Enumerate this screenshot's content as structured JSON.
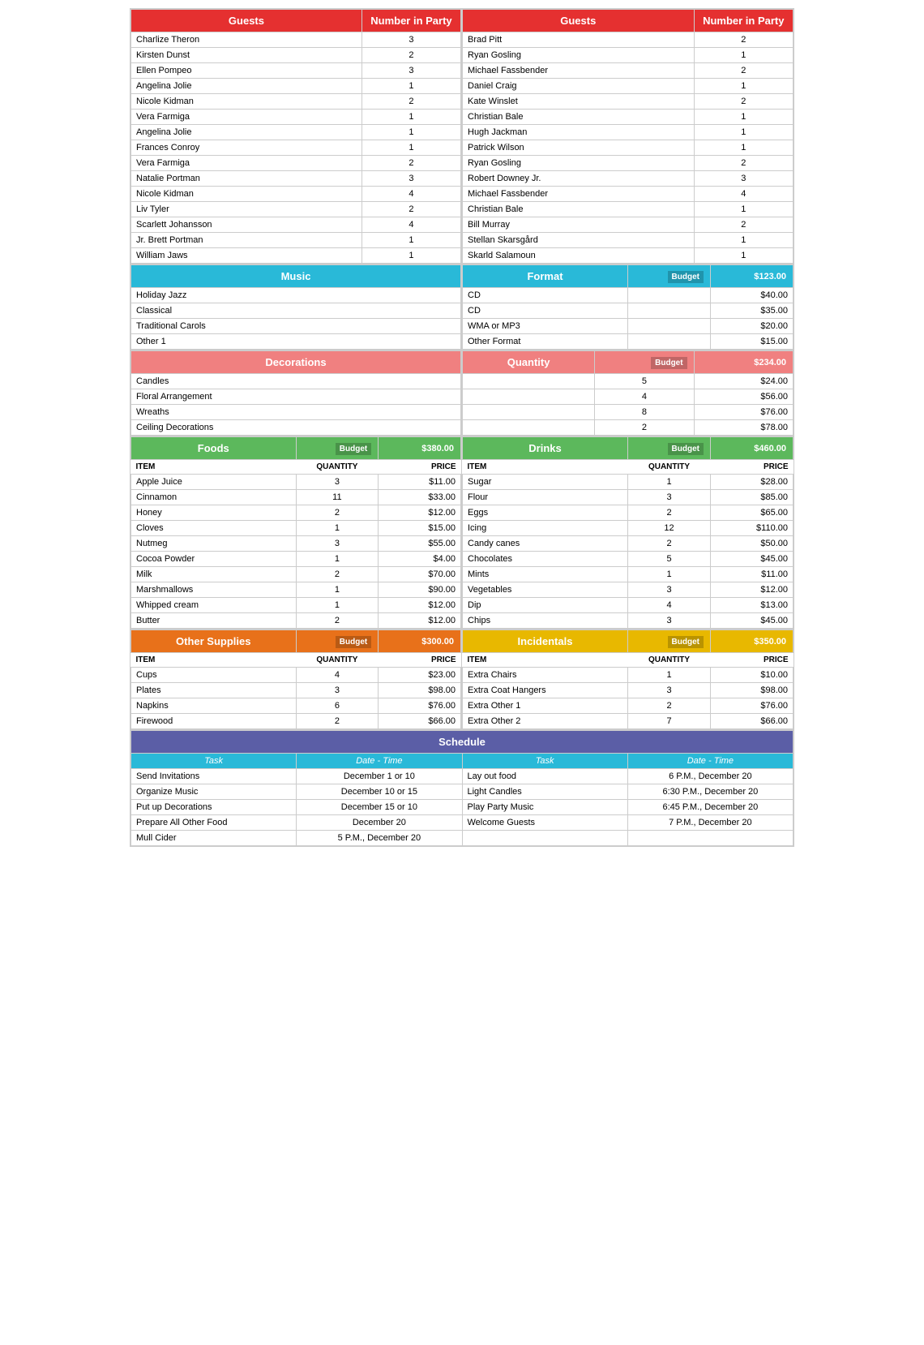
{
  "guests_left": {
    "header": "Guests",
    "col2": "Number in Party",
    "rows": [
      {
        "name": "Charlize Theron",
        "party": "3"
      },
      {
        "name": "Kirsten Dunst",
        "party": "2"
      },
      {
        "name": "Ellen Pompeo",
        "party": "3"
      },
      {
        "name": "Angelina Jolie",
        "party": "1"
      },
      {
        "name": "Nicole Kidman",
        "party": "2"
      },
      {
        "name": "Vera Farmiga",
        "party": "1"
      },
      {
        "name": "Angelina Jolie",
        "party": "1"
      },
      {
        "name": "Frances Conroy",
        "party": "1"
      },
      {
        "name": "Vera Farmiga",
        "party": "2"
      },
      {
        "name": "Natalie Portman",
        "party": "3"
      },
      {
        "name": "Nicole Kidman",
        "party": "4"
      },
      {
        "name": "Liv Tyler",
        "party": "2"
      },
      {
        "name": "Scarlett Johansson",
        "party": "4"
      },
      {
        "name": "Jr. Brett Portman",
        "party": "1"
      },
      {
        "name": "William Jaws",
        "party": "1"
      }
    ]
  },
  "guests_right": {
    "header": "Guests",
    "col2": "Number in Party",
    "rows": [
      {
        "name": "Brad Pitt",
        "party": "2"
      },
      {
        "name": "Ryan Gosling",
        "party": "1"
      },
      {
        "name": "Michael Fassbender",
        "party": "2"
      },
      {
        "name": "Daniel Craig",
        "party": "1"
      },
      {
        "name": "Kate Winslet",
        "party": "2"
      },
      {
        "name": "Christian Bale",
        "party": "1"
      },
      {
        "name": "Hugh Jackman",
        "party": "1"
      },
      {
        "name": "Patrick Wilson",
        "party": "1"
      },
      {
        "name": "Ryan Gosling",
        "party": "2"
      },
      {
        "name": "Robert Downey Jr.",
        "party": "3"
      },
      {
        "name": "Michael Fassbender",
        "party": "4"
      },
      {
        "name": "Christian Bale",
        "party": "1"
      },
      {
        "name": "Bill Murray",
        "party": "2"
      },
      {
        "name": "Stellan Skarsgård",
        "party": "1"
      },
      {
        "name": "Skarld Salamoun",
        "party": "1"
      }
    ]
  },
  "music": {
    "header": "Music",
    "rows": [
      "Holiday Jazz",
      "Classical",
      "Traditional Carols",
      "Other 1"
    ]
  },
  "format": {
    "header": "Format",
    "budget_label": "Budget",
    "budget": "$123.00",
    "rows": [
      {
        "name": "CD",
        "price": "$40.00"
      },
      {
        "name": "CD",
        "price": "$35.00"
      },
      {
        "name": "WMA or MP3",
        "price": "$20.00"
      },
      {
        "name": "Other Format",
        "price": "$15.00"
      }
    ]
  },
  "decorations": {
    "header": "Decorations",
    "rows": [
      "Candles",
      "Floral Arrangement",
      "Wreaths",
      "Ceiling Decorations"
    ]
  },
  "quantity": {
    "header": "Quantity",
    "budget_label": "Budget",
    "budget": "$234.00",
    "rows": [
      {
        "qty": "5",
        "price": "$24.00"
      },
      {
        "qty": "4",
        "price": "$56.00"
      },
      {
        "qty": "8",
        "price": "$76.00"
      },
      {
        "qty": "2",
        "price": "$78.00"
      }
    ]
  },
  "foods": {
    "header": "Foods",
    "budget_label": "Budget",
    "budget": "$380.00",
    "col_item": "ITEM",
    "col_qty": "QUANTITY",
    "col_price": "PRICE",
    "rows": [
      {
        "item": "Apple Juice",
        "qty": "3",
        "price": "$11.00"
      },
      {
        "item": "Cinnamon",
        "qty": "11",
        "price": "$33.00"
      },
      {
        "item": "Honey",
        "qty": "2",
        "price": "$12.00"
      },
      {
        "item": "Cloves",
        "qty": "1",
        "price": "$15.00"
      },
      {
        "item": "Nutmeg",
        "qty": "3",
        "price": "$55.00"
      },
      {
        "item": "Cocoa Powder",
        "qty": "1",
        "price": "$4.00"
      },
      {
        "item": "Milk",
        "qty": "2",
        "price": "$70.00"
      },
      {
        "item": "Marshmallows",
        "qty": "1",
        "price": "$90.00"
      },
      {
        "item": "Whipped cream",
        "qty": "1",
        "price": "$12.00"
      },
      {
        "item": "Butter",
        "qty": "2",
        "price": "$12.00"
      }
    ]
  },
  "drinks": {
    "header": "Drinks",
    "budget_label": "Budget",
    "budget": "$460.00",
    "col_item": "ITEM",
    "col_qty": "QUANTITY",
    "col_price": "PRICE",
    "rows": [
      {
        "item": "Sugar",
        "qty": "1",
        "price": "$28.00"
      },
      {
        "item": "Flour",
        "qty": "3",
        "price": "$85.00"
      },
      {
        "item": "Eggs",
        "qty": "2",
        "price": "$65.00"
      },
      {
        "item": "Icing",
        "qty": "12",
        "price": "$110.00"
      },
      {
        "item": "Candy canes",
        "qty": "2",
        "price": "$50.00"
      },
      {
        "item": "Chocolates",
        "qty": "5",
        "price": "$45.00"
      },
      {
        "item": "Mints",
        "qty": "1",
        "price": "$11.00"
      },
      {
        "item": "Vegetables",
        "qty": "3",
        "price": "$12.00"
      },
      {
        "item": "Dip",
        "qty": "4",
        "price": "$13.00"
      },
      {
        "item": "Chips",
        "qty": "3",
        "price": "$45.00"
      }
    ]
  },
  "other_supplies": {
    "header": "Other Supplies",
    "budget_label": "Budget",
    "budget": "$300.00",
    "col_item": "ITEM",
    "col_qty": "QUANTITY",
    "col_price": "PRICE",
    "rows": [
      {
        "item": "Cups",
        "qty": "4",
        "price": "$23.00"
      },
      {
        "item": "Plates",
        "qty": "3",
        "price": "$98.00"
      },
      {
        "item": "Napkins",
        "qty": "6",
        "price": "$76.00"
      },
      {
        "item": "Firewood",
        "qty": "2",
        "price": "$66.00"
      }
    ]
  },
  "incidentals": {
    "header": "Incidentals",
    "budget_label": "Budget",
    "budget": "$350.00",
    "col_item": "ITEM",
    "col_qty": "QUANTITY",
    "col_price": "PRICE",
    "rows": [
      {
        "item": "Extra Chairs",
        "qty": "1",
        "price": "$10.00"
      },
      {
        "item": "Extra Coat Hangers",
        "qty": "3",
        "price": "$98.00"
      },
      {
        "item": "Extra Other 1",
        "qty": "2",
        "price": "$76.00"
      },
      {
        "item": "Extra Other 2",
        "qty": "7",
        "price": "$66.00"
      }
    ]
  },
  "schedule": {
    "header": "Schedule",
    "col_task": "Task",
    "col_datetime": "Date - Time",
    "left_rows": [
      {
        "task": "Send Invitations",
        "datetime": "December 1 or 10"
      },
      {
        "task": "Organize Music",
        "datetime": "December 10 or 15"
      },
      {
        "task": "Put up Decorations",
        "datetime": "December 15 or 10"
      },
      {
        "task": "Prepare All Other Food",
        "datetime": "December 20"
      },
      {
        "task": "Mull Cider",
        "datetime": "5 P.M., December 20"
      }
    ],
    "right_rows": [
      {
        "task": "Lay out food",
        "datetime": "6 P.M., December 20"
      },
      {
        "task": "Light Candles",
        "datetime": "6:30 P.M., December 20"
      },
      {
        "task": "Play Party Music",
        "datetime": "6:45 P.M., December 20"
      },
      {
        "task": "Welcome Guests",
        "datetime": "7 P.M., December 20"
      }
    ]
  }
}
